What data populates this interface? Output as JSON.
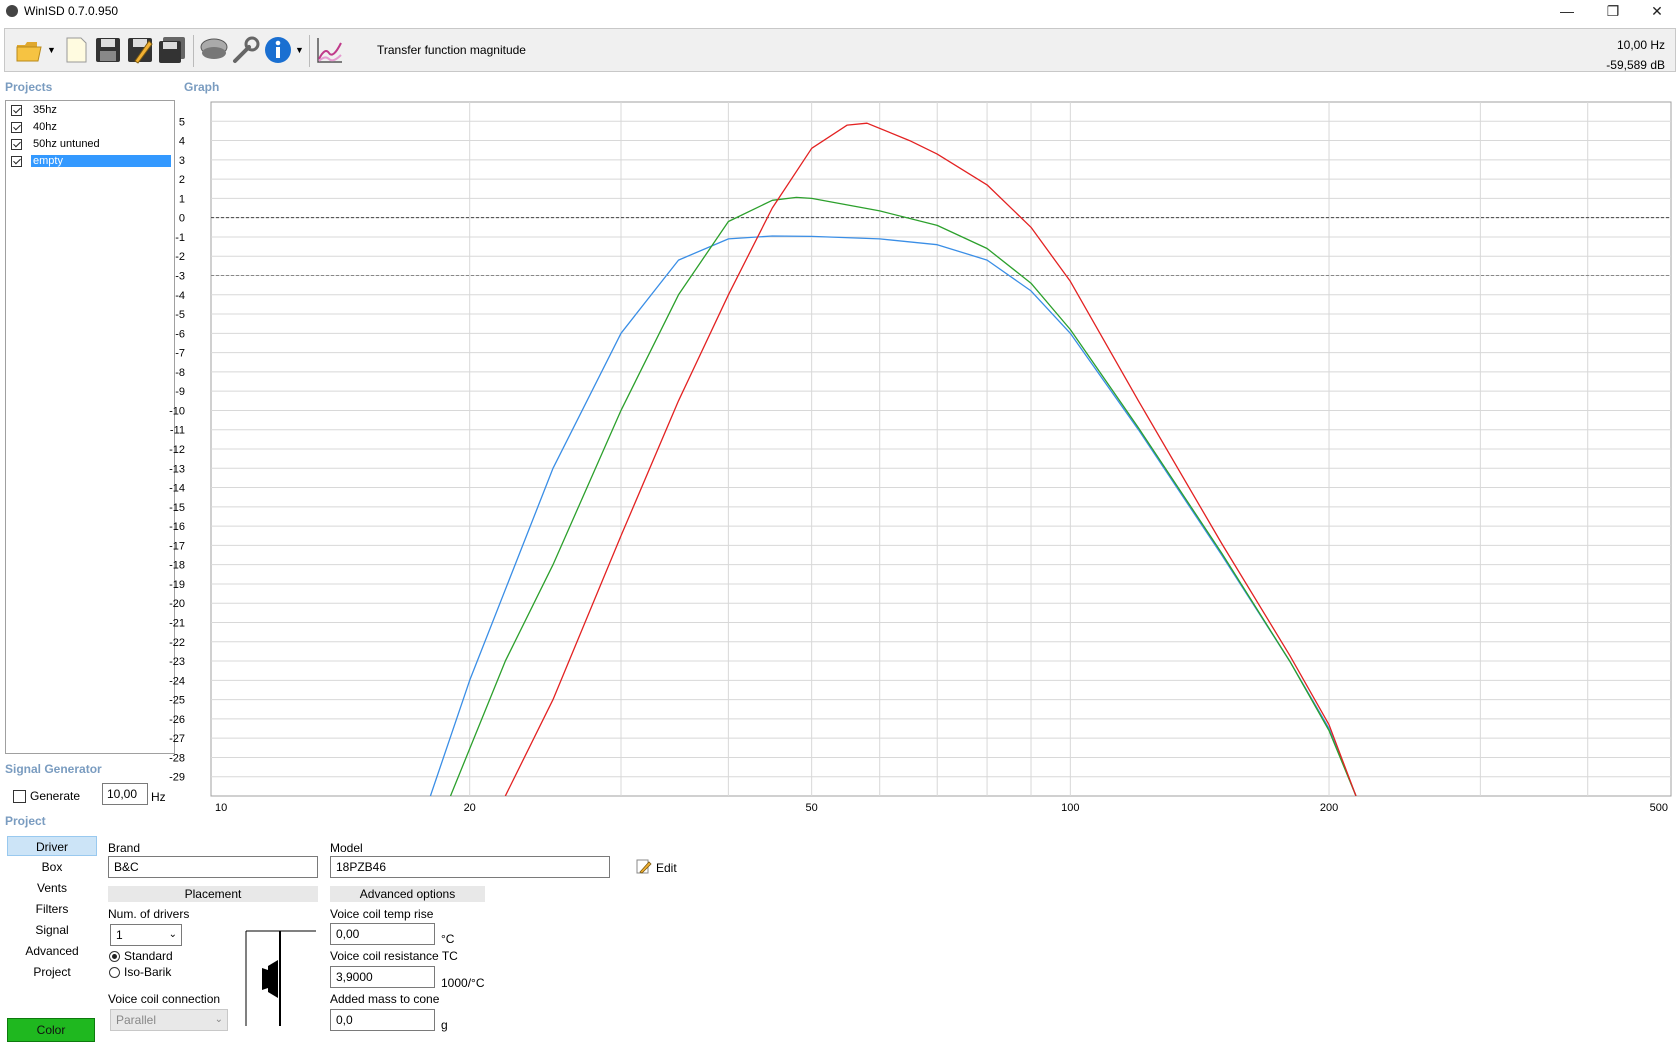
{
  "window": {
    "title": "WinISD 0.7.0.950",
    "minimize": "—",
    "restore": "❐",
    "close": "✕"
  },
  "toolbar": {
    "graph_type_label": "Transfer function magnitude",
    "readout_freq": "10,00 Hz",
    "readout_db": "-59,589 dB",
    "icons": [
      "open-folder-icon",
      "new-document-icon",
      "save-icon",
      "save-as-icon",
      "save-all-icon",
      "speaker-icon",
      "settings-wrench-icon",
      "info-icon",
      "graph-icon"
    ]
  },
  "sections": {
    "projects": "Projects",
    "graph": "Graph",
    "signal_generator": "Signal Generator",
    "project": "Project"
  },
  "projects": [
    {
      "label": "35hz",
      "checked": true,
      "selected": false
    },
    {
      "label": "40hz",
      "checked": true,
      "selected": false
    },
    {
      "label": "50hz untuned",
      "checked": true,
      "selected": false
    },
    {
      "label": "empty",
      "checked": true,
      "selected": true
    }
  ],
  "signal_generator": {
    "generate_label": "Generate",
    "freq_value": "10,00",
    "unit": "Hz",
    "generate_checked": false
  },
  "project_nav": {
    "items": [
      "Driver",
      "Box",
      "Vents",
      "Filters",
      "Signal",
      "Advanced",
      "Project"
    ],
    "active": "Driver",
    "color_button": "Color",
    "color_value": "#1fb81f"
  },
  "driver": {
    "brand_label": "Brand",
    "brand_value": "B&C",
    "model_label": "Model",
    "model_value": "18PZB46",
    "edit_label": "Edit",
    "placement_header": "Placement",
    "num_drivers_label": "Num. of drivers",
    "num_drivers_value": "1",
    "standard_label": "Standard",
    "isobarik_label": "Iso-Barik",
    "vc_connection_label": "Voice coil connection",
    "vc_connection_value": "Parallel",
    "advanced_header": "Advanced options",
    "vc_temp_label": "Voice coil temp rise",
    "vc_temp_value": "0,00",
    "vc_temp_unit": "°C",
    "vc_res_label": "Voice coil resistance TC",
    "vc_res_value": "3,9000",
    "vc_res_unit": "1000/°C",
    "mass_label": "Added mass to cone",
    "mass_value": "0,0",
    "mass_unit": "g"
  },
  "chart_data": {
    "type": "line",
    "xscale": "log",
    "xlim": [
      10,
      500
    ],
    "ylim": [
      -30,
      6
    ],
    "x_tick_labels": [
      10,
      20,
      50,
      100,
      200,
      500
    ],
    "y_ticks": [
      5,
      4,
      3,
      2,
      1,
      0,
      -1,
      -2,
      -3,
      -4,
      -5,
      -6,
      -7,
      -8,
      -9,
      -10,
      -11,
      -12,
      -13,
      -14,
      -15,
      -16,
      -17,
      -18,
      -19,
      -20,
      -21,
      -22,
      -23,
      -24,
      -25,
      -26,
      -27,
      -28,
      -29
    ],
    "ref_lines": [
      0,
      -3
    ],
    "series": [
      {
        "color": "#3a8ee6",
        "points": [
          [
            18,
            -30
          ],
          [
            20,
            -24
          ],
          [
            25,
            -13
          ],
          [
            30,
            -6
          ],
          [
            35,
            -2.2
          ],
          [
            40,
            -1.1
          ],
          [
            45,
            -0.95
          ],
          [
            50,
            -0.97
          ],
          [
            60,
            -1.1
          ],
          [
            70,
            -1.4
          ],
          [
            80,
            -2.2
          ],
          [
            90,
            -3.8
          ],
          [
            100,
            -6
          ],
          [
            120,
            -11
          ],
          [
            150,
            -17.5
          ],
          [
            180,
            -23
          ],
          [
            200,
            -26.5
          ],
          [
            215,
            -30
          ]
        ]
      },
      {
        "color": "#2ca02c",
        "points": [
          [
            19,
            -30
          ],
          [
            22,
            -23
          ],
          [
            25,
            -18
          ],
          [
            30,
            -10
          ],
          [
            35,
            -4
          ],
          [
            40,
            -0.2
          ],
          [
            45,
            0.9
          ],
          [
            48,
            1.05
          ],
          [
            50,
            1
          ],
          [
            60,
            0.35
          ],
          [
            70,
            -0.4
          ],
          [
            80,
            -1.6
          ],
          [
            90,
            -3.4
          ],
          [
            100,
            -5.8
          ],
          [
            120,
            -10.9
          ],
          [
            150,
            -17.4
          ],
          [
            180,
            -23
          ],
          [
            200,
            -26.6
          ],
          [
            215,
            -30
          ]
        ]
      },
      {
        "color": "#e32222",
        "points": [
          [
            22,
            -30
          ],
          [
            25,
            -25
          ],
          [
            30,
            -16.5
          ],
          [
            35,
            -9.5
          ],
          [
            40,
            -4
          ],
          [
            45,
            0.5
          ],
          [
            50,
            3.6
          ],
          [
            55,
            4.8
          ],
          [
            58,
            4.9
          ],
          [
            65,
            4
          ],
          [
            70,
            3.3
          ],
          [
            80,
            1.7
          ],
          [
            90,
            -0.5
          ],
          [
            100,
            -3.3
          ],
          [
            120,
            -9.5
          ],
          [
            150,
            -16.9
          ],
          [
            180,
            -22.7
          ],
          [
            200,
            -26.3
          ],
          [
            215,
            -30
          ]
        ]
      }
    ]
  }
}
